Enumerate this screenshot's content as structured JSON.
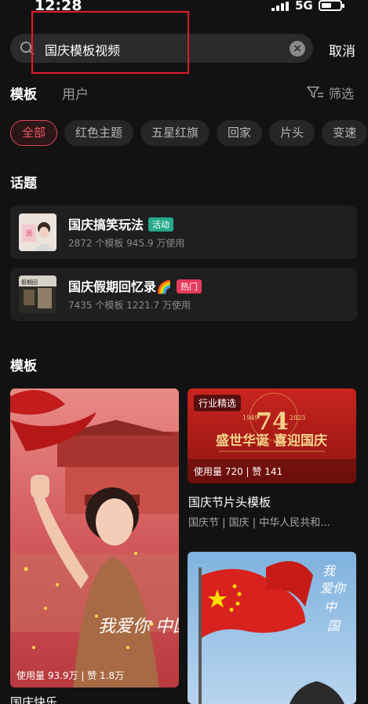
{
  "status_bar": {
    "time": "12:28",
    "network": "5G"
  },
  "search": {
    "query": "国庆模板视频",
    "cancel_label": "取消"
  },
  "tabs": [
    {
      "label": "模板",
      "active": true
    },
    {
      "label": "用户",
      "active": false
    }
  ],
  "filter": {
    "label": "筛选"
  },
  "chips": [
    "全部",
    "红色主题",
    "五星红旗",
    "回家",
    "片头",
    "变速"
  ],
  "topics_section": {
    "title": "话题"
  },
  "topics": [
    {
      "name": "国庆搞笑玩法",
      "badge": "活动",
      "badge_color": "#24a98c",
      "stats": "2872 个模板  945.9 万使用"
    },
    {
      "name": "国庆假期回忆录🌈",
      "badge": "热门",
      "badge_color": "#e63c5c",
      "stats": "7435 个模板  1221.7 万使用"
    }
  ],
  "templates_section": {
    "title": "模板"
  },
  "templates": [
    {
      "overlay_text": "我爱你 中国",
      "stats": "使用量 93.9万 | 赞 1.8万",
      "title": "国庆快乐"
    },
    {
      "tag": "行业精选",
      "banner_years": "1949 74 2023",
      "banner_title": "盛世华诞 喜迎国庆",
      "stats": "使用量 720 | 赞 141",
      "title": "国庆节片头模板",
      "subtitle": "国庆节 | 国庆 | 中华人民共和..."
    },
    {
      "overlay_text": "我爱你 中国"
    }
  ],
  "colors": {
    "accent": "#e0455a",
    "background": "#121212"
  }
}
